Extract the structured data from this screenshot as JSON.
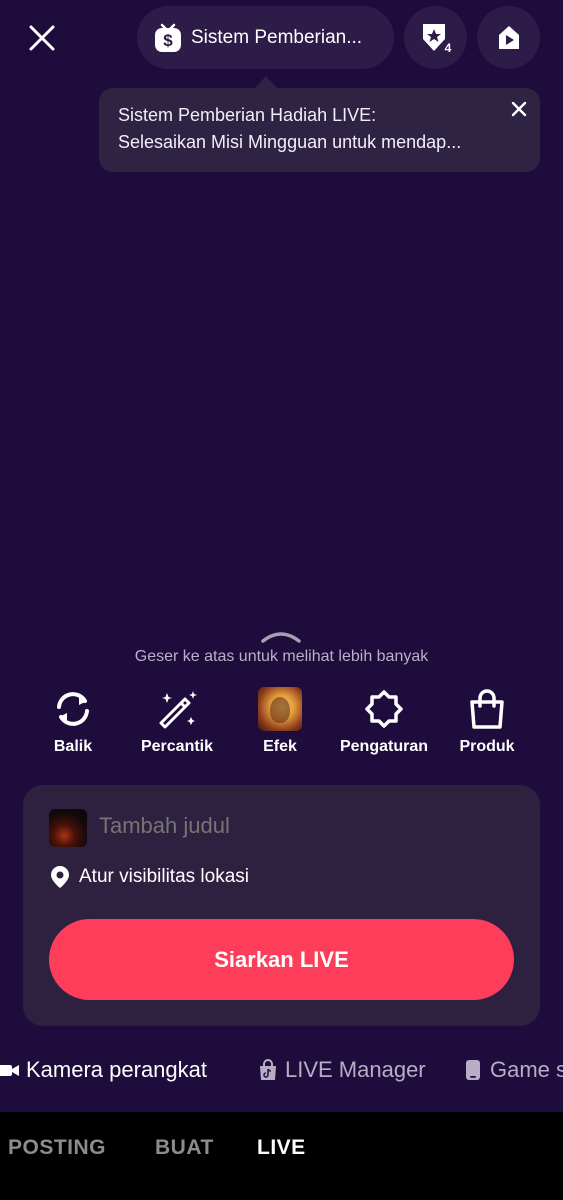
{
  "top_bar": {
    "reward_pill_label": "Sistem Pemberian...",
    "rank_badge": "4",
    "icons": [
      "close-icon",
      "reward-coin-icon",
      "star-rank-icon",
      "play-icon"
    ]
  },
  "tooltip": {
    "line1": "Sistem Pemberian Hadiah LIVE:",
    "line2": "Selesaikan Misi Mingguan untuk mendap..."
  },
  "swipe_hint": "Geser ke atas untuk melihat lebih banyak",
  "tools": [
    {
      "label": "Balik",
      "icon": "flip-camera-icon"
    },
    {
      "label": "Percantik",
      "icon": "beauty-wand-icon"
    },
    {
      "label": "Efek",
      "icon": "effect-thumbnail"
    },
    {
      "label": "Pengaturan",
      "icon": "gear-icon"
    },
    {
      "label": "Produk",
      "icon": "shopping-bag-icon"
    }
  ],
  "panel": {
    "title_placeholder": "Tambah judul",
    "location_label": "Atur visibilitas lokasi",
    "go_live_label": "Siarkan LIVE"
  },
  "sources": [
    {
      "label": "Kamera perangkat",
      "icon": "video-camera-icon",
      "active": true
    },
    {
      "label": "LIVE Manager",
      "icon": "tiktok-bag-icon",
      "active": false
    },
    {
      "label": "Game s",
      "icon": "phone-icon",
      "active": false
    }
  ],
  "modes": [
    {
      "label": "POSTING",
      "active": false
    },
    {
      "label": "BUAT",
      "active": false
    },
    {
      "label": "LIVE",
      "active": true
    }
  ],
  "colors": {
    "background": "#1e0c3c",
    "accent": "#fd3d59",
    "panel": "#2e2140"
  }
}
